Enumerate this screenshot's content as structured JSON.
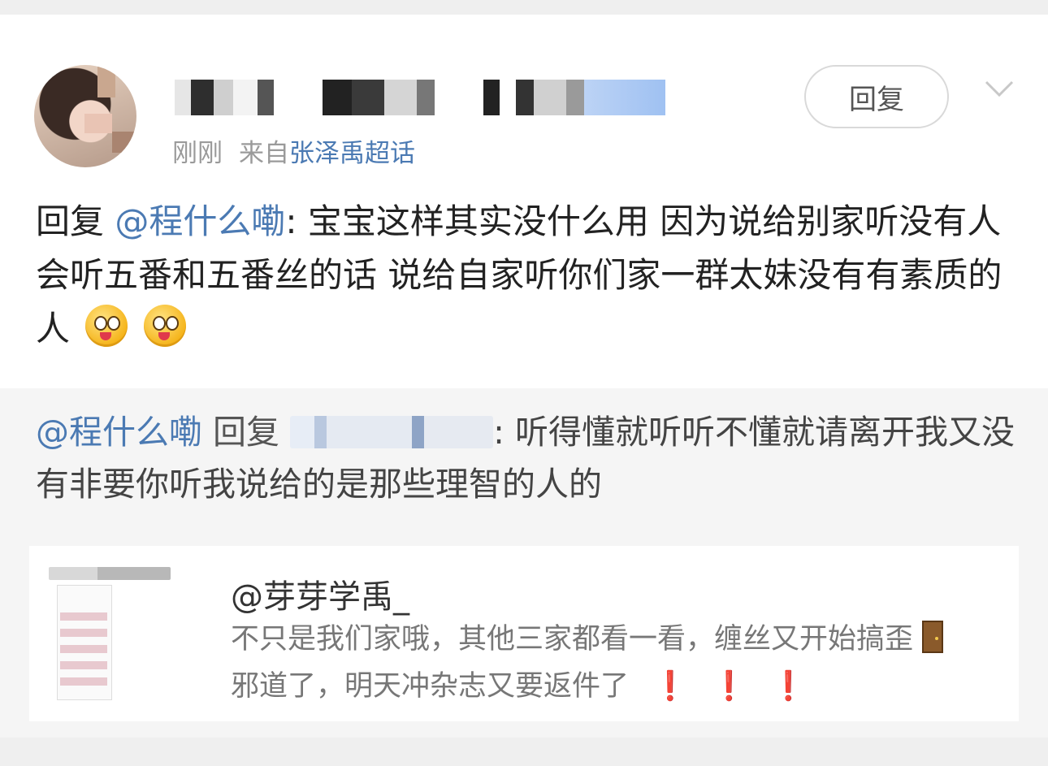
{
  "post": {
    "time": "刚刚",
    "from_label": "来自",
    "topic": "张泽禹超话",
    "reply_button": "回复",
    "content_reply_word": "回复",
    "content_mention": "@程什么嘞",
    "content_text": ": 宝宝这样其实没什么用  因为说给别家听没有人会听五番和五番丝的话  说给自家听你们家一群太妹没有有素质的人",
    "emoji_icons": [
      "tongue-face-emoji",
      "tongue-face-emoji"
    ]
  },
  "repost": {
    "mention": "@程什么嘞",
    "reply_word": "回复",
    "text": ": 听得懂就听听不懂就请离开我又没有非要你听我说给的是那些理智的人的"
  },
  "quote": {
    "user": "@芽芽学禹_",
    "text": "不只是我们家哦，其他三家都看一看，缠丝又开始搞歪",
    "text2": "邪道了，明天冲杂志又要返件了",
    "bangs": [
      "❗",
      "❗",
      "❗"
    ]
  },
  "colors": {
    "link": "#4b7ab3",
    "background": "#efefef",
    "repost_bg": "#f5f5f5",
    "alert": "#e1252b"
  }
}
